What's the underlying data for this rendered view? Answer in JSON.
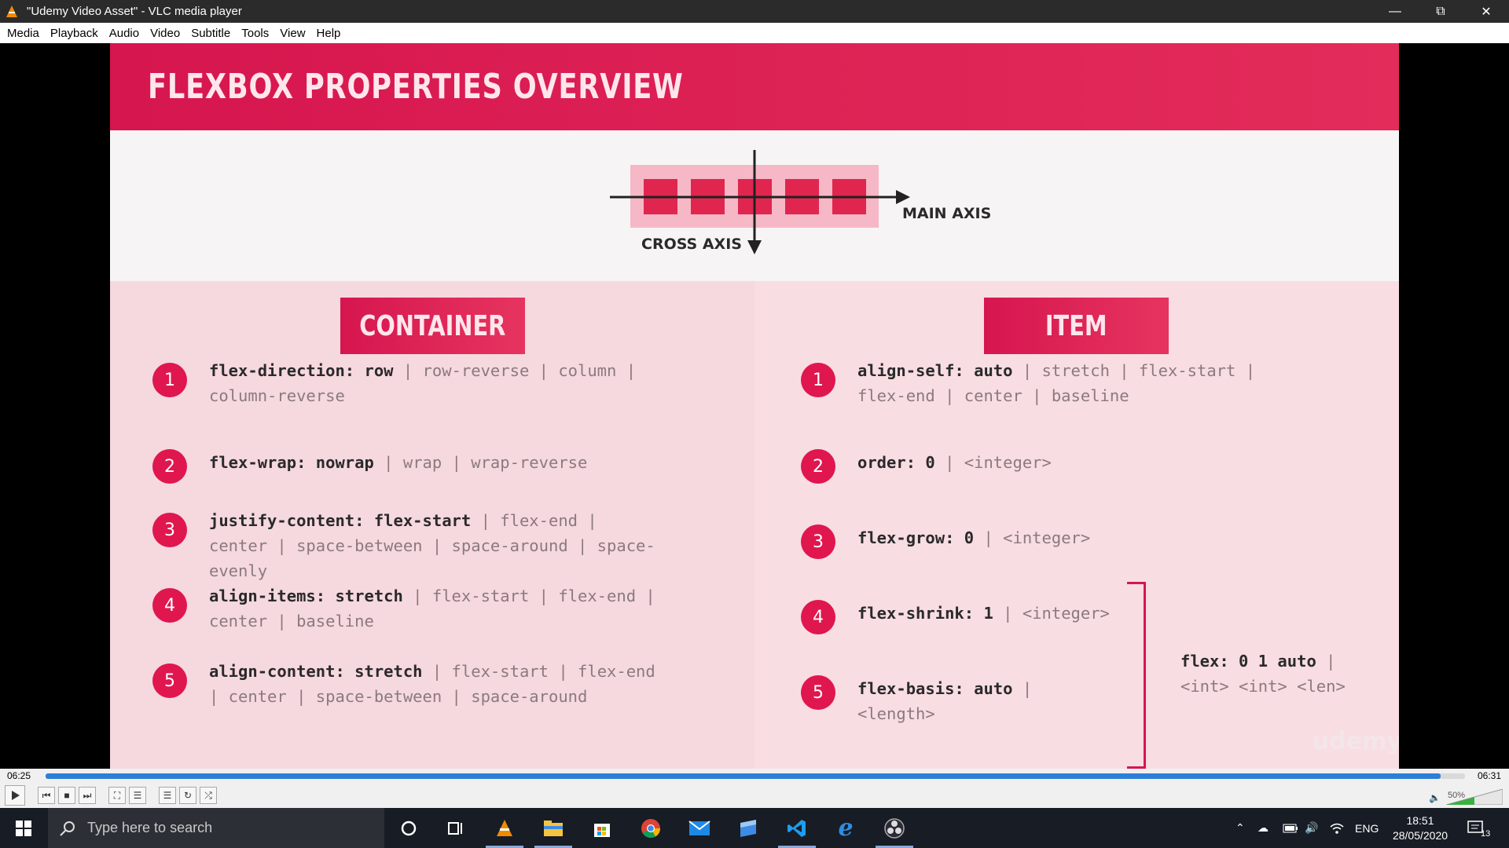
{
  "window": {
    "title": "\"Udemy Video Asset\" - VLC media player"
  },
  "menu": [
    "Media",
    "Playback",
    "Audio",
    "Video",
    "Subtitle",
    "Tools",
    "View",
    "Help"
  ],
  "slide": {
    "title": "FLEXBOX PROPERTIES OVERVIEW",
    "diagram": {
      "main_axis": "MAIN AXIS",
      "cross_axis": "CROSS AXIS"
    },
    "container": {
      "heading": "CONTAINER",
      "items": [
        {
          "num": "1",
          "key": "flex-direction: row",
          "rest": " | row-reverse | column | column-reverse"
        },
        {
          "num": "2",
          "key": "flex-wrap: nowrap",
          "rest": " | wrap | wrap-reverse"
        },
        {
          "num": "3",
          "key": "justify-content: flex-start",
          "rest": " | flex-end | center | space-between | space-around | space-evenly"
        },
        {
          "num": "4",
          "key": "align-items: stretch",
          "rest": " | flex-start | flex-end | center | baseline"
        },
        {
          "num": "5",
          "key": "align-content: stretch",
          "rest": " | flex-start | flex-end | center | space-between | space-around"
        }
      ]
    },
    "item": {
      "heading": "ITEM",
      "items": [
        {
          "num": "1",
          "key": "align-self: auto",
          "rest": " | stretch | flex-start | flex-end | center | baseline"
        },
        {
          "num": "2",
          "key": "order: 0",
          "rest": " | <integer>"
        },
        {
          "num": "3",
          "key": "flex-grow: 0",
          "rest": " | <integer>"
        },
        {
          "num": "4",
          "key": "flex-shrink: 1",
          "rest": " | <integer>"
        },
        {
          "num": "5",
          "key": "flex-basis: auto",
          "rest": " | <length>"
        }
      ],
      "shorthand_key": "flex: 0 1 auto",
      "shorthand_rest": " | <int> <int> <len>"
    },
    "watermark": "udemy"
  },
  "player": {
    "elapsed": "06:25",
    "total": "06:31",
    "progress": 0.983,
    "volume": "50%"
  },
  "taskbar": {
    "search_placeholder": "Type here to search",
    "language": "ENG",
    "time": "18:51",
    "date": "28/05/2020",
    "notifications": "13"
  }
}
